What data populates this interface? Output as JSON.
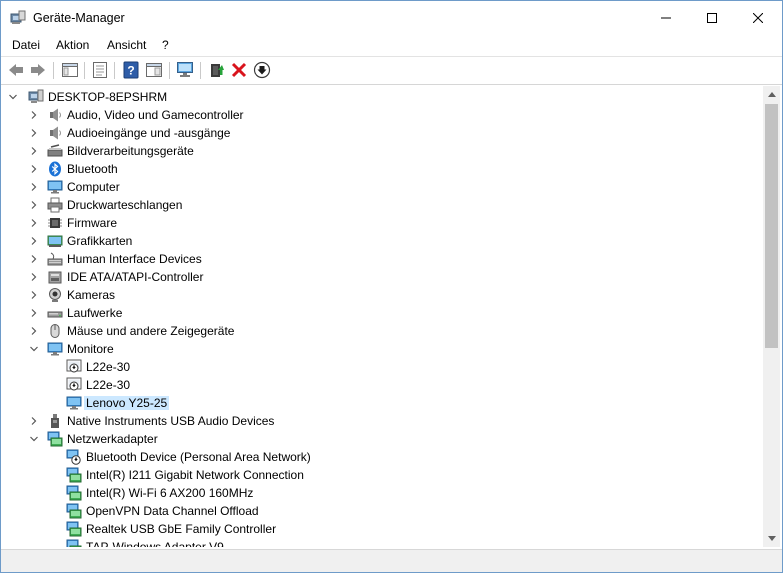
{
  "window": {
    "title": "Geräte-Manager"
  },
  "menu": [
    "Datei",
    "Aktion",
    "Ansicht",
    "?"
  ],
  "tree": {
    "root": "DESKTOP-8EPSHRM",
    "categories": [
      {
        "label": "Audio, Video und Gamecontroller",
        "icon": "speaker-icon"
      },
      {
        "label": "Audioeingänge und -ausgänge",
        "icon": "speaker-icon"
      },
      {
        "label": "Bildverarbeitungsgeräte",
        "icon": "scanner-icon"
      },
      {
        "label": "Bluetooth",
        "icon": "bluetooth-icon"
      },
      {
        "label": "Computer",
        "icon": "monitor-icon"
      },
      {
        "label": "Druckwarteschlangen",
        "icon": "printer-icon"
      },
      {
        "label": "Firmware",
        "icon": "chip-icon"
      },
      {
        "label": "Grafikkarten",
        "icon": "display-adapter-icon"
      },
      {
        "label": "Human Interface Devices",
        "icon": "hid-icon"
      },
      {
        "label": "IDE ATA/ATAPI-Controller",
        "icon": "ide-icon"
      },
      {
        "label": "Kameras",
        "icon": "camera-icon"
      },
      {
        "label": "Laufwerke",
        "icon": "drive-icon"
      },
      {
        "label": "Mäuse und andere Zeigegeräte",
        "icon": "mouse-icon"
      },
      {
        "label": "Monitore",
        "icon": "monitor-icon",
        "expanded": true,
        "children": [
          {
            "label": "L22e-30",
            "icon": "monitor-warning-icon"
          },
          {
            "label": "L22e-30",
            "icon": "monitor-warning-icon"
          },
          {
            "label": "Lenovo Y25-25",
            "icon": "monitor-icon",
            "selected": true
          }
        ]
      },
      {
        "label": "Native Instruments USB Audio Devices",
        "icon": "usb-icon"
      },
      {
        "label": "Netzwerkadapter",
        "icon": "network-icon",
        "expanded": true,
        "children": [
          {
            "label": "Bluetooth Device (Personal Area Network)",
            "icon": "network-warning-icon"
          },
          {
            "label": "Intel(R) I211 Gigabit Network Connection",
            "icon": "network-icon"
          },
          {
            "label": "Intel(R) Wi-Fi 6 AX200 160MHz",
            "icon": "network-icon"
          },
          {
            "label": "OpenVPN Data Channel Offload",
            "icon": "network-icon"
          },
          {
            "label": "Realtek USB GbE Family Controller",
            "icon": "network-icon"
          },
          {
            "label": "TAP-Windows Adapter V9",
            "icon": "network-icon"
          }
        ]
      }
    ]
  }
}
